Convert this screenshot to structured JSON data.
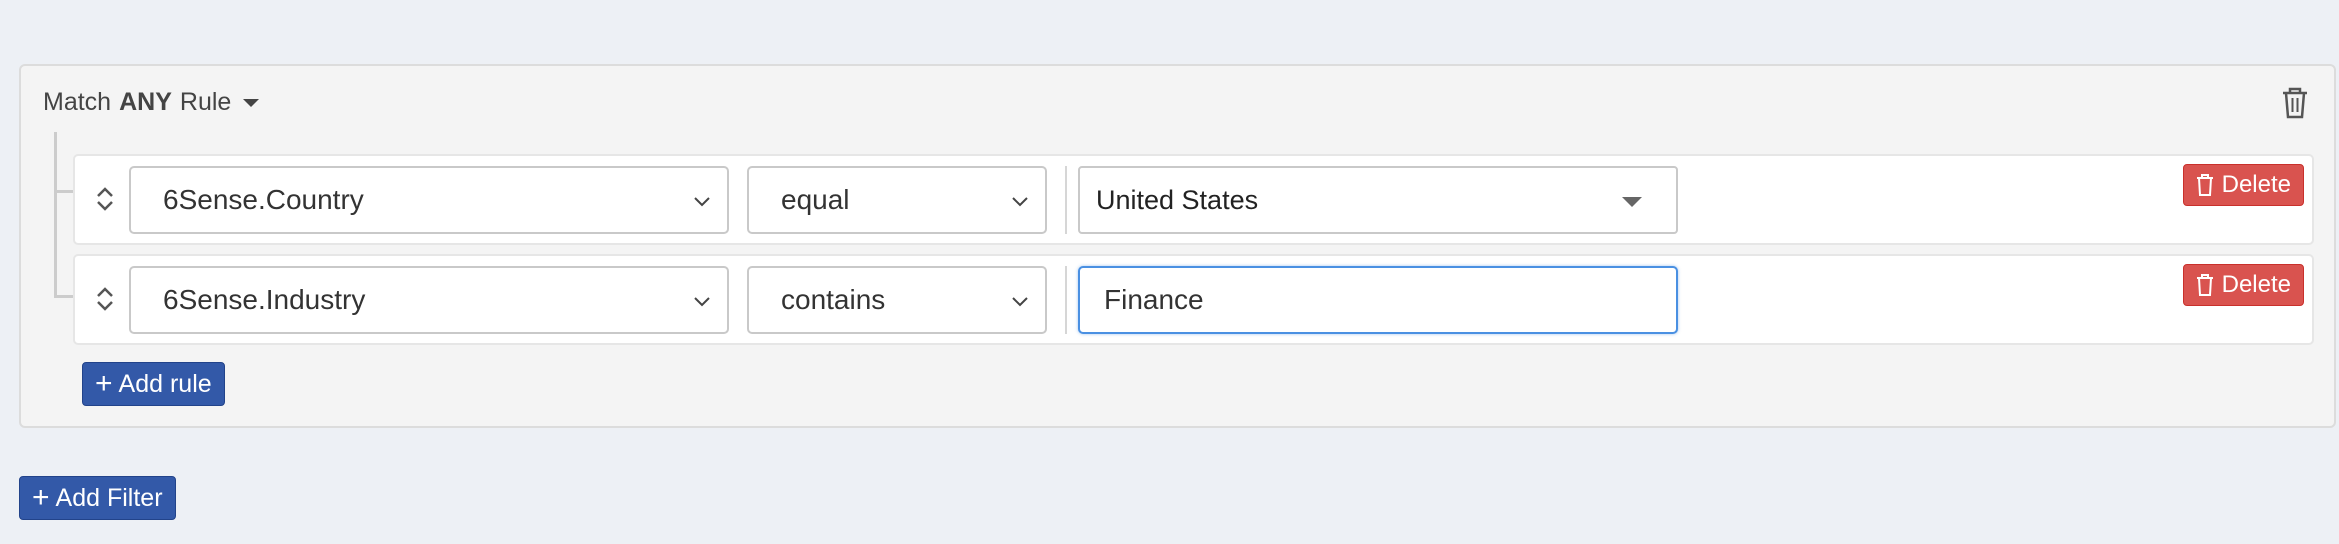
{
  "group": {
    "prefix": "Match",
    "conjunction": "ANY",
    "suffix": "Rule",
    "caret_icon": "caret-down-icon",
    "delete_icon": "trash-icon"
  },
  "rules": [
    {
      "field": "6Sense.Country",
      "operator": "equal",
      "value": "United States",
      "value_type": "select",
      "delete_label": "Delete"
    },
    {
      "field": "6Sense.Industry",
      "operator": "contains",
      "value": "Finance",
      "value_type": "text",
      "delete_label": "Delete"
    }
  ],
  "add_rule_label": "Add rule",
  "add_filter_label": "Add Filter",
  "colors": {
    "background": "#edf0f5",
    "primary": "#3359a8",
    "danger": "#d9534f",
    "focus": "#4a90e2"
  }
}
